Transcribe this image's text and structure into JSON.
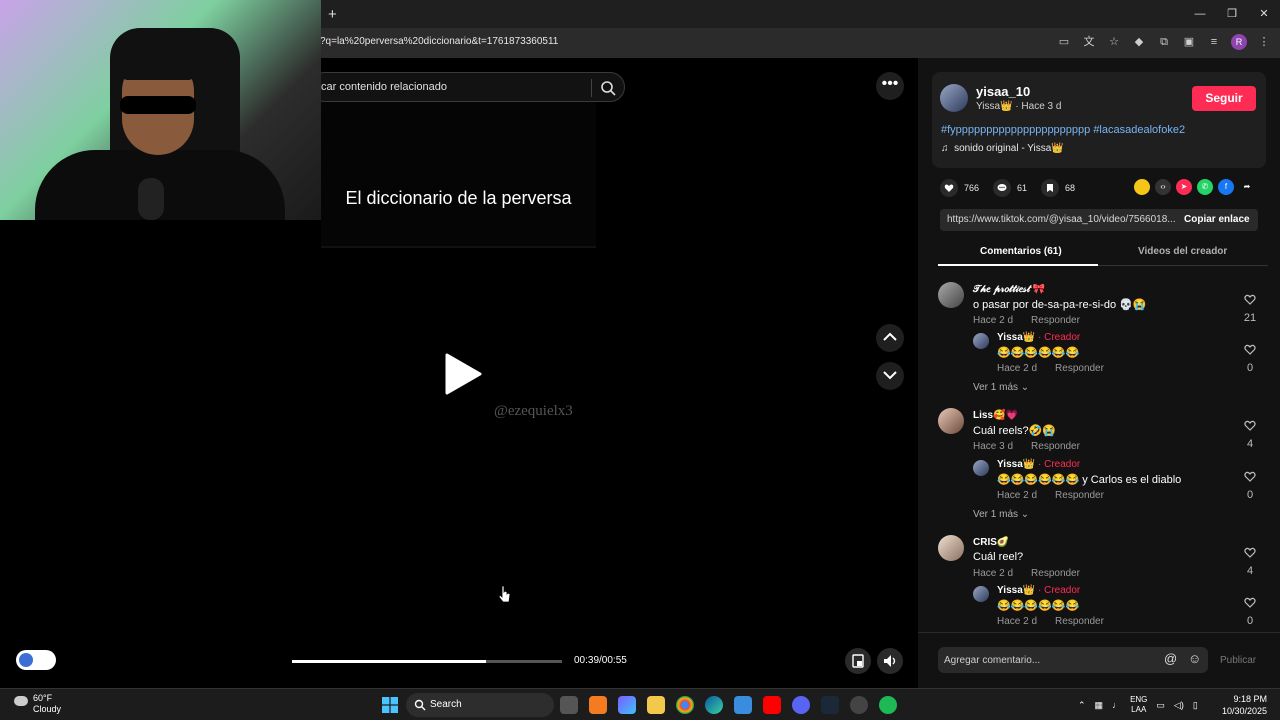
{
  "browser": {
    "new_tab": "+",
    "url": "?q=la%20perversa%20diccionario&t=1761873360511",
    "window_controls": [
      "—",
      "❒",
      "✕"
    ],
    "profile_initial": "R"
  },
  "search": {
    "placeholder": "car contenido relacionado"
  },
  "video": {
    "title": "El diccionario de la perversa",
    "watermark": "@ezequielx3",
    "time": "00:39/00:55",
    "progress": 0.72
  },
  "creator": {
    "username": "yisaa_10",
    "nickname": "Yissa👑",
    "date": "· Hace 3 d",
    "follow_label": "Seguir",
    "hashtags": "#fypppppppppppppppppppppp #lacasadealofoke2",
    "sound": "sonido original - Yissa👑"
  },
  "stats": {
    "likes": "766",
    "comments": "61",
    "saves": "68"
  },
  "link": {
    "url": "https://www.tiktok.com/@yisaa_10/video/7566018...",
    "copy_label": "Copiar enlace"
  },
  "tabs": {
    "comments": "Comentarios (61)",
    "creator_videos": "Videos del creador"
  },
  "comments": [
    {
      "name": "𝒯𝒽𝑒 𝓅𝓇𝑜𝓉𝓉𝒾𝑒𝓈𝓉 🎀",
      "text": "o pasar por de-sa-pa-re-si-do 💀😭",
      "date": "Hace 2 d",
      "reply_label": "Responder",
      "likes": "21",
      "reply": {
        "name": "Yissa👑",
        "badge": "· Creador",
        "text": "😂😂😂😂😂😂",
        "date": "Hace 2 d",
        "reply_label": "Responder",
        "likes": "0"
      },
      "more": "Ver 1 más ⌄"
    },
    {
      "name": "Liss🥰💗",
      "text": "Cuál reels?🤣😭",
      "date": "Hace 3 d",
      "reply_label": "Responder",
      "likes": "4",
      "reply": {
        "name": "Yissa👑",
        "badge": "· Creador",
        "text": "😂😂😂😂😂😂 y Carlos es el diablo",
        "date": "Hace 2 d",
        "reply_label": "Responder",
        "likes": "0"
      },
      "more": "Ver 1 más ⌄"
    },
    {
      "name": "CRIS🥑",
      "text": "Cuál reel?",
      "date": "Hace 2 d",
      "reply_label": "Responder",
      "likes": "4",
      "reply": {
        "name": "Yissa👑",
        "badge": "· Creador",
        "text": "😂😂😂😂😂😂",
        "date": "Hace 2 d",
        "reply_label": "Responder",
        "likes": "0"
      }
    }
  ],
  "comment_input": {
    "placeholder": "Agregar comentario...",
    "post_label": "Publicar"
  },
  "taskbar": {
    "weather_temp": "60°F",
    "weather_desc": "Cloudy",
    "search_label": "Search",
    "lang_1": "ENG",
    "lang_2": "LAA",
    "time": "9:18 PM",
    "date": "10/30/2025"
  },
  "colors": {
    "accent": "#fe2c55",
    "hashtag": "#78b4f5",
    "panel_bg": "#121212"
  }
}
